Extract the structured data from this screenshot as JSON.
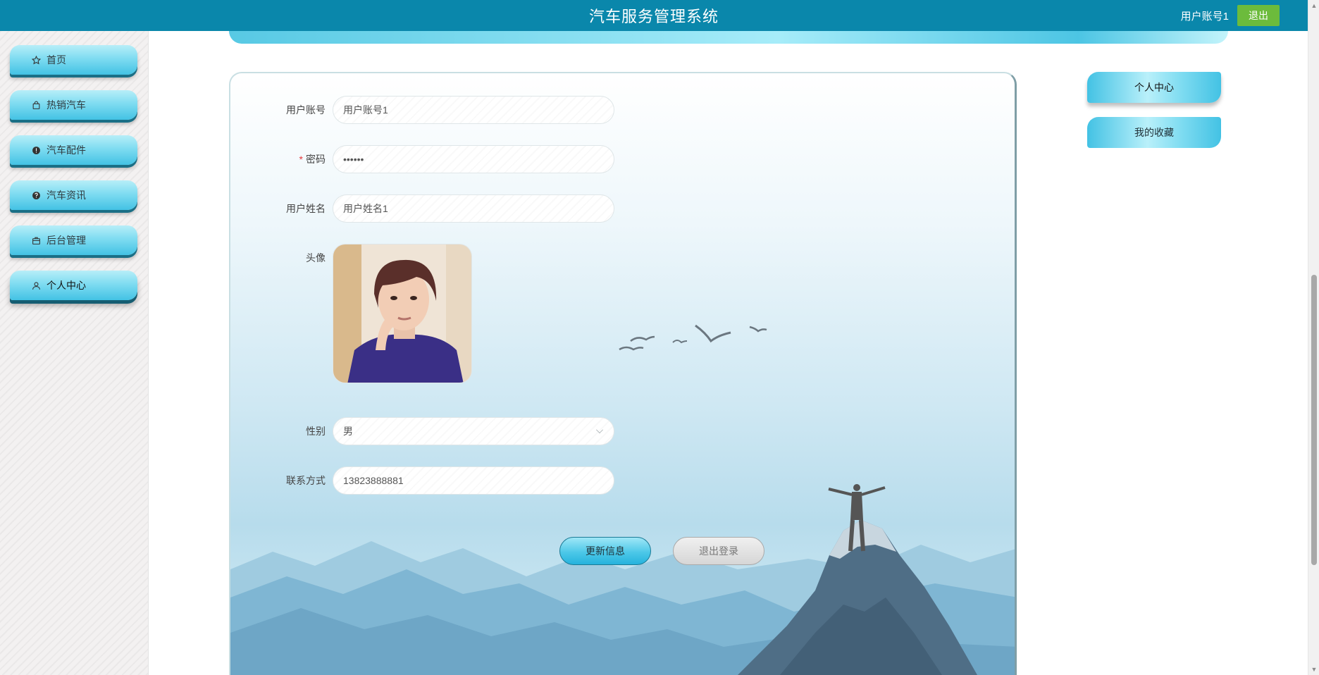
{
  "header": {
    "title": "汽车服务管理系统",
    "username": "用户账号1",
    "logout_label": "退出"
  },
  "sidebar": {
    "items": [
      {
        "label": "首页",
        "icon": "star-icon"
      },
      {
        "label": "热销汽车",
        "icon": "bag-icon"
      },
      {
        "label": "汽车配件",
        "icon": "info-circle-icon"
      },
      {
        "label": "汽车资讯",
        "icon": "question-circle-icon"
      },
      {
        "label": "后台管理",
        "icon": "briefcase-icon"
      },
      {
        "label": "个人中心",
        "icon": "user-icon",
        "active": true
      }
    ]
  },
  "form": {
    "account_label": "用户账号",
    "account_value": "用户账号1",
    "password_label": "密码",
    "password_required_mark": "*",
    "password_value": "••••••",
    "name_label": "用户姓名",
    "name_value": "用户姓名1",
    "avatar_label": "头像",
    "gender_label": "性别",
    "gender_value": "男",
    "phone_label": "联系方式",
    "phone_value": "13823888881",
    "update_button": "更新信息",
    "logout_button": "退出登录"
  },
  "right_panel": {
    "items": [
      {
        "label": "个人中心",
        "active": true
      },
      {
        "label": "我的收藏",
        "active": false
      }
    ]
  },
  "colors": {
    "header_bg": "#0a87ab",
    "logout_green": "#6cbb3c",
    "accent_cyan": "#43c2e4"
  }
}
